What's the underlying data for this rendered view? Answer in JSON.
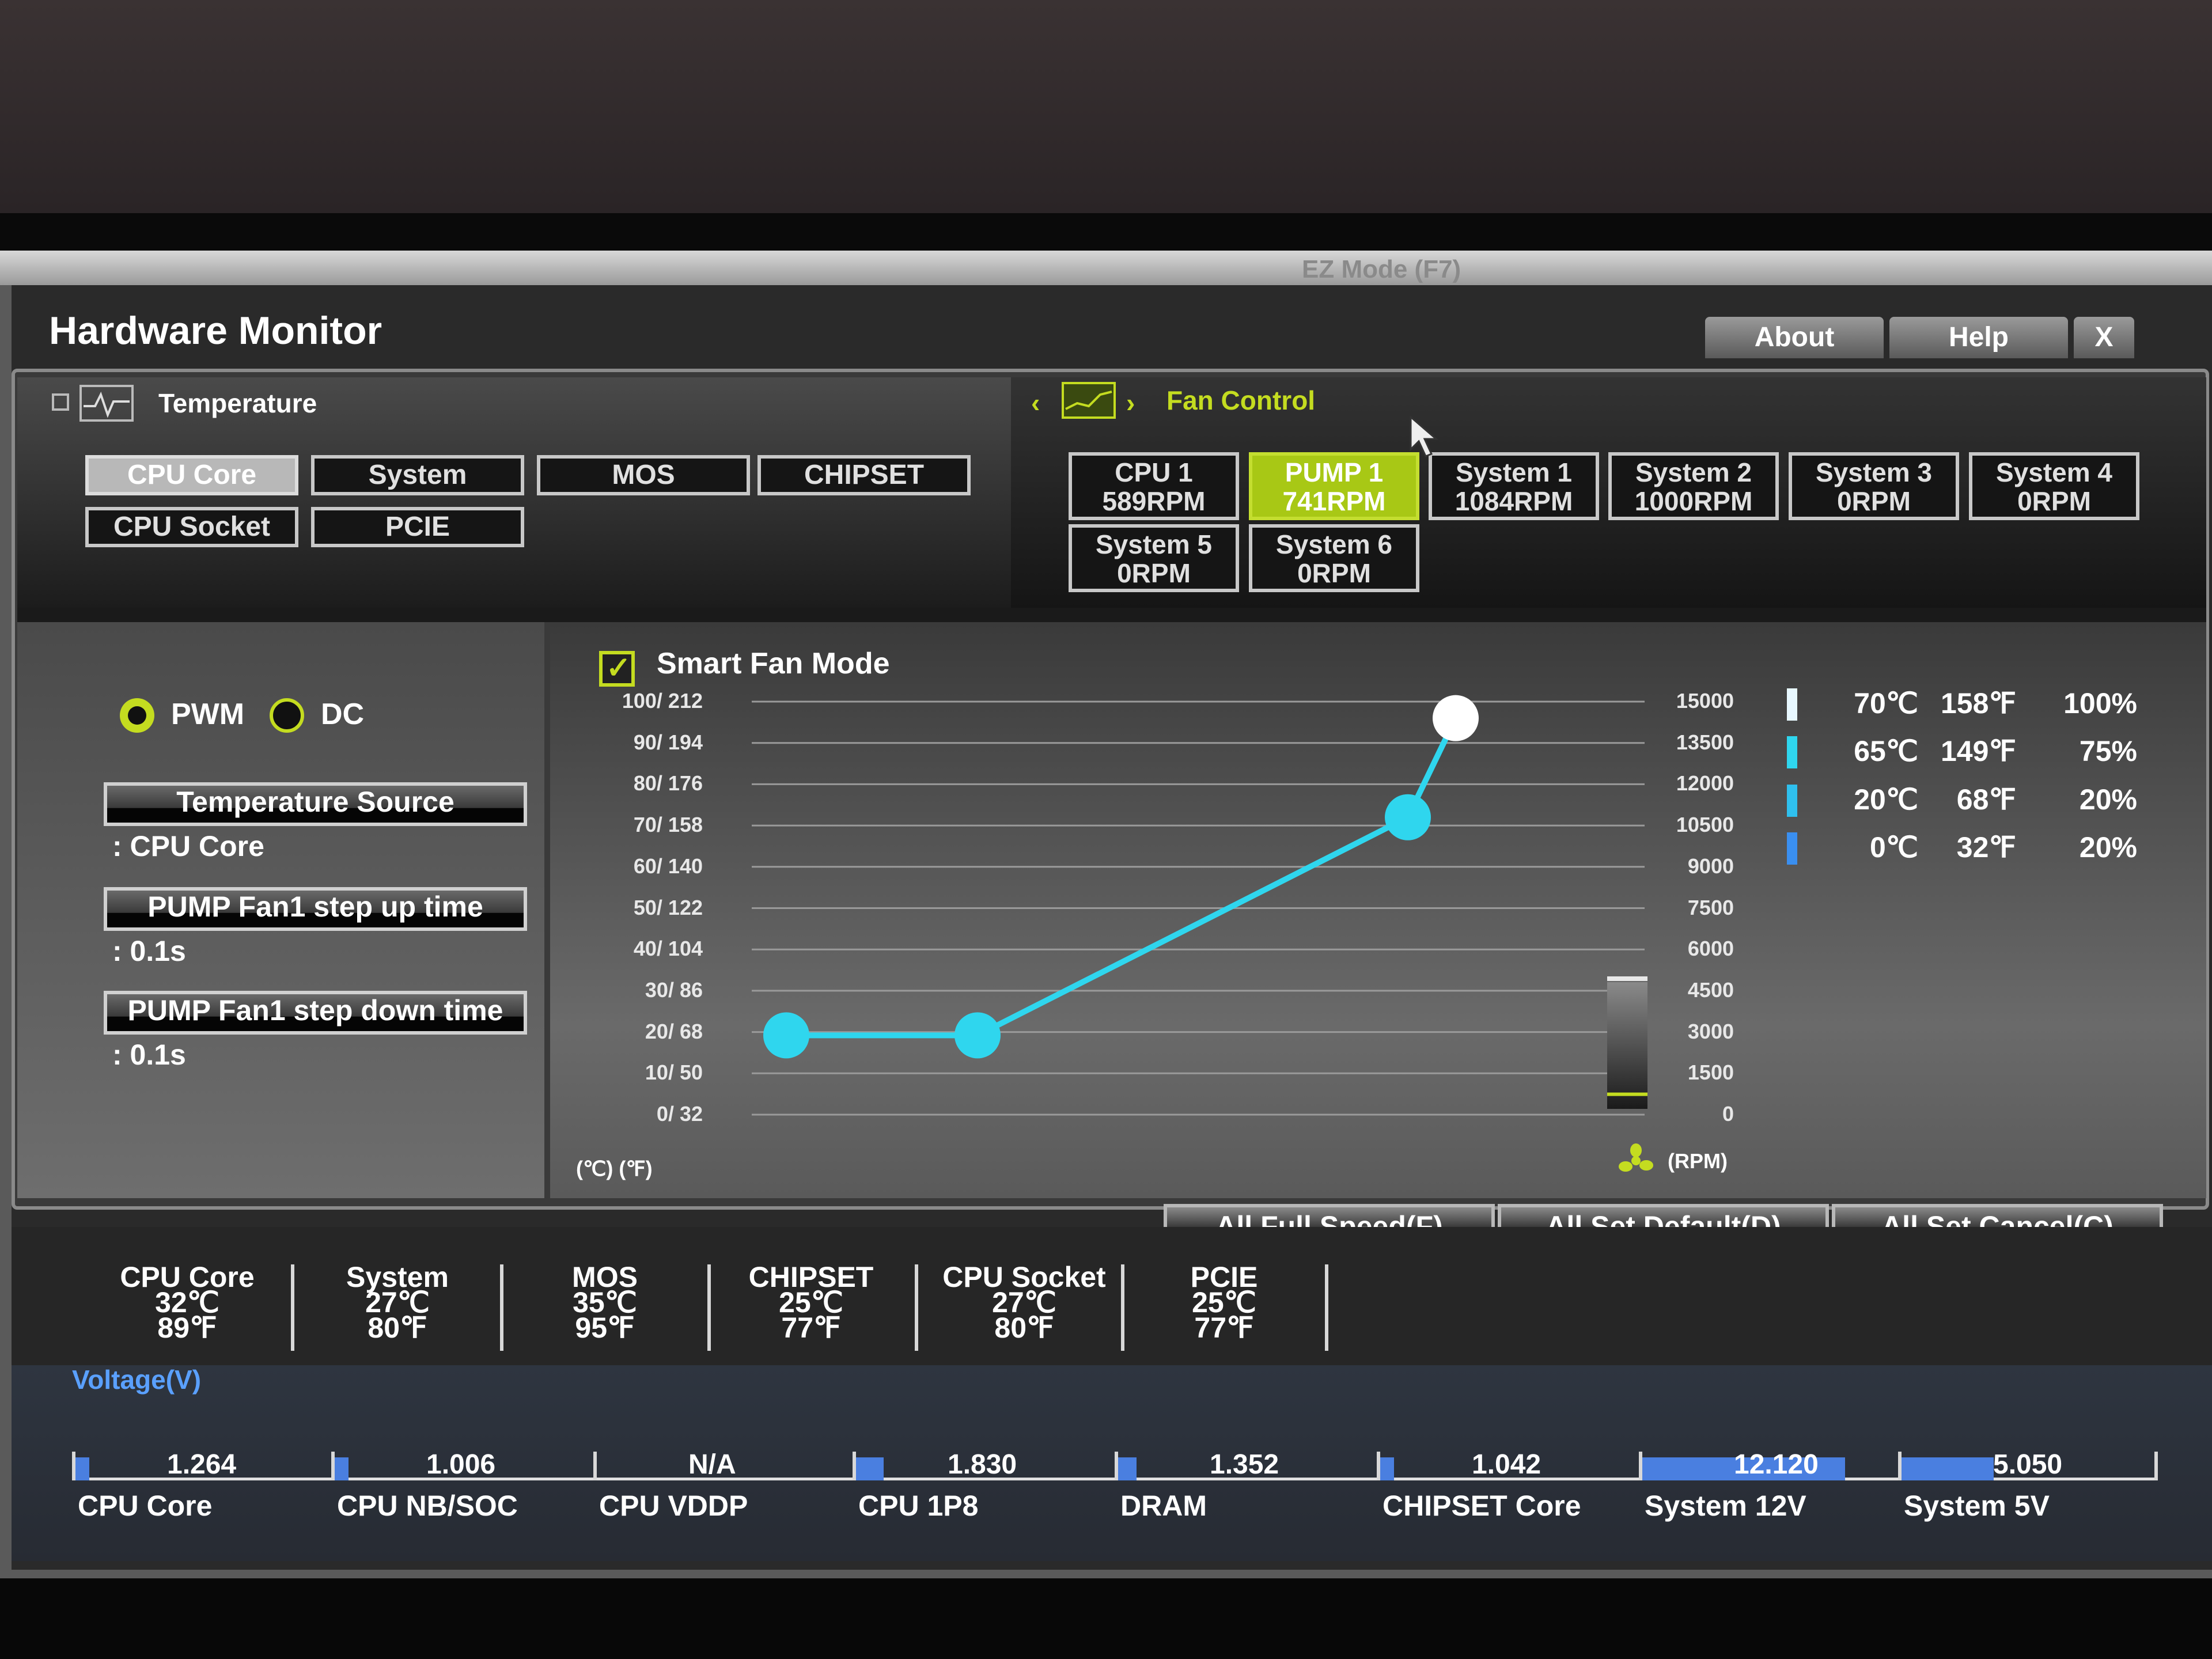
{
  "header": {
    "title": "Hardware Monitor",
    "about": "About",
    "help": "Help",
    "close": "X",
    "background_hint": "EZ Mode (F7)"
  },
  "sections": {
    "temperature": "Temperature",
    "fan_control": "Fan Control"
  },
  "temp_sources": [
    "CPU Core",
    "System",
    "MOS",
    "CHIPSET",
    "CPU Socket",
    "PCIE"
  ],
  "active_temp_source": "CPU Core",
  "fans": [
    {
      "name": "CPU 1",
      "rpm": "589RPM"
    },
    {
      "name": "PUMP 1",
      "rpm": "741RPM",
      "active": true
    },
    {
      "name": "System 1",
      "rpm": "1084RPM"
    },
    {
      "name": "System 2",
      "rpm": "1000RPM"
    },
    {
      "name": "System 3",
      "rpm": "0RPM"
    },
    {
      "name": "System 4",
      "rpm": "0RPM"
    },
    {
      "name": "System 5",
      "rpm": "0RPM"
    },
    {
      "name": "System 6",
      "rpm": "0RPM"
    }
  ],
  "settings": {
    "pwm_label": "PWM",
    "dc_label": "DC",
    "mode_selected": "PWM",
    "temp_source_btn": "Temperature Source",
    "temp_source_val": ": CPU Core",
    "step_up_btn": "PUMP Fan1 step up time",
    "step_up_val": ": 0.1s",
    "step_down_btn": "PUMP Fan1 step down time",
    "step_down_val": ": 0.1s"
  },
  "smart_fan": {
    "label": "Smart Fan Mode",
    "checked": true,
    "unit_temp": "(℃)   (℉)",
    "unit_rpm": "(RPM)"
  },
  "chart_data": {
    "type": "line",
    "left_ticks": [
      "100/ 212",
      "90/ 194",
      "80/ 176",
      "70/ 158",
      "60/ 140",
      "50/ 122",
      "40/ 104",
      "30/  86",
      "20/  68",
      "10/  50",
      "0/  32"
    ],
    "right_ticks": [
      "15000",
      "13500",
      "12000",
      "10500",
      "9000",
      "7500",
      "6000",
      "4500",
      "3000",
      "1500",
      "0"
    ],
    "points": [
      {
        "temp_c": 0,
        "temp_f": 32,
        "duty": 20
      },
      {
        "temp_c": 20,
        "temp_f": 68,
        "duty": 20
      },
      {
        "temp_c": 65,
        "temp_f": 149,
        "duty": 75
      },
      {
        "temp_c": 70,
        "temp_f": 158,
        "duty": 100
      }
    ],
    "current_rpm": 741,
    "line_color": "#2fd6ee",
    "top_point_color": "#ffffff"
  },
  "legend": [
    {
      "c": "70℃",
      "f": "158℉",
      "pct": "100%",
      "color": "#e8f8ff"
    },
    {
      "c": "65℃",
      "f": "149℉",
      "pct": "75%",
      "color": "#2fd6ee"
    },
    {
      "c": "20℃",
      "f": "68℉",
      "pct": "20%",
      "color": "#2fc0ee"
    },
    {
      "c": "0℃",
      "f": "32℉",
      "pct": "20%",
      "color": "#3a8ff0"
    }
  ],
  "actions": {
    "full_speed": "All Full Speed(F)",
    "set_default": "All Set Default(D)",
    "set_cancel": "All Set Cancel(C)"
  },
  "temps": [
    {
      "name": "CPU Core",
      "c": "32℃",
      "f": "89℉"
    },
    {
      "name": "System",
      "c": "27℃",
      "f": "80℉"
    },
    {
      "name": "MOS",
      "c": "35℃",
      "f": "95℉"
    },
    {
      "name": "CHIPSET",
      "c": "25℃",
      "f": "77℉"
    },
    {
      "name": "CPU Socket",
      "c": "27℃",
      "f": "80℉"
    },
    {
      "name": "PCIE",
      "c": "25℃",
      "f": "77℉"
    }
  ],
  "voltage": {
    "title": "Voltage(V)",
    "items": [
      {
        "name": "CPU Core",
        "value": "1.264",
        "level": 0.05
      },
      {
        "name": "CPU NB/SOC",
        "value": "1.006",
        "level": 0.04
      },
      {
        "name": "CPU VDDP",
        "value": "N/A",
        "level": 0
      },
      {
        "name": "CPU 1P8",
        "value": "1.830",
        "level": 0.12
      },
      {
        "name": "DRAM",
        "value": "1.352",
        "level": 0.08
      },
      {
        "name": "CHIPSET Core",
        "value": "1.042",
        "level": 0.04
      },
      {
        "name": "System 12V",
        "value": "12.120",
        "level": 0.88
      },
      {
        "name": "System 5V",
        "value": "5.050",
        "level": 0.4
      }
    ]
  }
}
